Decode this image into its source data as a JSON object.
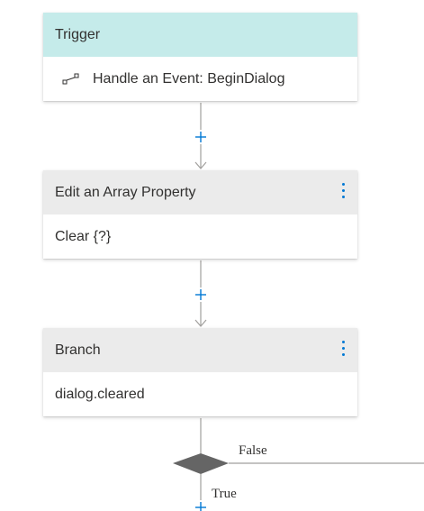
{
  "nodes": {
    "trigger": {
      "header": "Trigger",
      "body": "Handle an Event: BeginDialog",
      "icon": "event-trigger-icon",
      "header_color": "#c5ebea"
    },
    "edit_array": {
      "header": "Edit an Array Property",
      "body": "Clear {?}",
      "header_color": "#ebebeb"
    },
    "branch": {
      "header": "Branch",
      "body": "dialog.cleared",
      "header_color": "#ebebeb"
    }
  },
  "branch_labels": {
    "false_label": "False",
    "true_label": "True"
  },
  "colors": {
    "accent": "#0078d4",
    "edge": "#a19f9d",
    "diamond": "#656565"
  }
}
